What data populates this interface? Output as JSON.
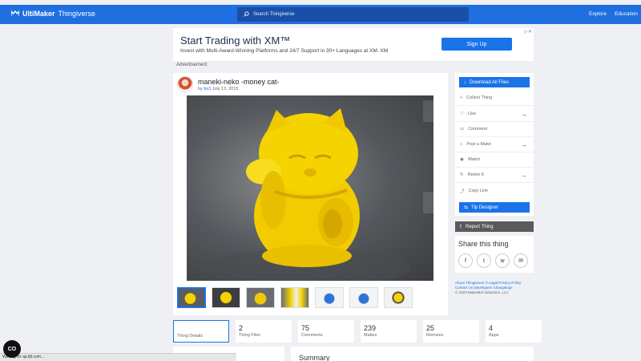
{
  "header": {
    "brand_bold": "UltiMaker",
    "brand_thin": "Thingiverse",
    "search_placeholder": "Search Thingiverse",
    "nav": [
      "Explore",
      "Education"
    ]
  },
  "ad": {
    "title": "Start Trading with XM™",
    "subtitle": "Invest with Multi-Award-Winning Platforms and 24/7 Support in 30+ Languages at XM. XM",
    "button": "Sign Up",
    "label": "Advertisement"
  },
  "thing": {
    "title": "maneki-neko -money cat-",
    "by_prefix": "by",
    "author": "bs3",
    "date": "July 13, 2015"
  },
  "sidebar": {
    "download": "Download All Files",
    "items": [
      {
        "label": "Collect Thing",
        "icon": "plus-icon",
        "arrow": false
      },
      {
        "label": "Like",
        "icon": "heart-icon",
        "arrow": true
      },
      {
        "label": "Comment",
        "icon": "comment-icon",
        "arrow": false
      },
      {
        "label": "Post a Make",
        "icon": "post-make-icon",
        "arrow": true
      },
      {
        "label": "Watch",
        "icon": "eye-icon",
        "arrow": false
      },
      {
        "label": "Remix It",
        "icon": "remix-icon",
        "arrow": true
      },
      {
        "label": "Copy Link",
        "icon": "link-icon",
        "arrow": false
      }
    ],
    "tip": "Tip Designer",
    "report": "Report Thing"
  },
  "share": {
    "title": "Share this thing",
    "icons": [
      "f",
      "t",
      "w",
      "m"
    ]
  },
  "footer": {
    "line1": "About Thingiverse ® Legal Privacy Policy",
    "line2": "Contact Us Developers Changelogs",
    "copyright": "© 2023 MakerBot Industries, LLC"
  },
  "stats": [
    {
      "num": "",
      "label": "Thing Details",
      "active": true
    },
    {
      "num": "2",
      "label": "Thing Files"
    },
    {
      "num": "75",
      "label": "Comments"
    },
    {
      "num": "239",
      "label": "Makes"
    },
    {
      "num": "25",
      "label": "Remixes"
    },
    {
      "num": "4",
      "label": "Apps"
    }
  ],
  "summary": "Summary",
  "status_bar": "Waiting for ap.fjit.com...",
  "cookie_label": "CO",
  "colors": {
    "primary": "#1a73e8",
    "header": "#1f6fe0",
    "cat_yellow": "#f5d300"
  }
}
